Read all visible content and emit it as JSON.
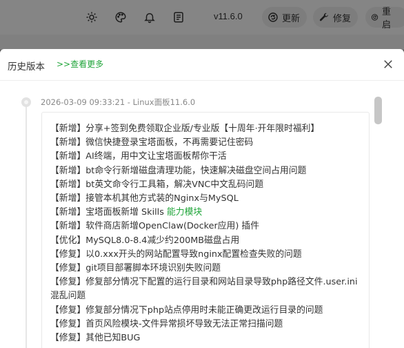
{
  "toolbar": {
    "version": "v11.6.0",
    "update_label": "更新",
    "repair_label": "修复",
    "restart_label": "重启",
    "icons": [
      "sun-icon",
      "palette-icon",
      "bell-icon",
      "notes-icon"
    ]
  },
  "modal": {
    "title": "历史版本",
    "more_link": ">>查看更多",
    "release": {
      "meta": "2026-03-09 09:33:21 - Linux面板11.6.0",
      "notes": [
        {
          "text": "【新增】分享+签到免费领取企业版/专业版【十周年·开年限时福利】"
        },
        {
          "text": "【新增】微信快捷登录宝塔面板，不再需要记住密码"
        },
        {
          "text": "【新增】AI终端，用中文让宝塔面板帮你干活"
        },
        {
          "text": "【新增】bt命令行新增磁盘清理功能，快速解决磁盘空间占用问题"
        },
        {
          "text": "【新增】bt英文命令行工具箱，解决VNC中文乱码问题"
        },
        {
          "text": "【新增】接管本机其他方式装的Nginx与MySQL"
        },
        {
          "text": "【新增】宝塔面板新增 Skills ",
          "highlight": "能力模块"
        },
        {
          "text": "【新增】软件商店新增OpenClaw(Docker应用) 插件"
        },
        {
          "text": "【优化】MySQL8.0-8.4减少约200MB磁盘占用"
        },
        {
          "text": "【修复】以0.xxx开头的网站配置导致nginx配置检查失败的问题"
        },
        {
          "text": "【修复】git项目部署脚本环境识别失败问题"
        },
        {
          "text": "【修复】修复部分情况下配置的运行目录和网站目录导致php路径文件.user.ini混乱问题"
        },
        {
          "text": "【修复】修复部分情况下php站点停用时未能正确更改运行目录的问题"
        },
        {
          "text": "【修复】首页风险模块-文件异常损坏导致无法正常扫描问题"
        },
        {
          "text": "【修复】其他已知BUG"
        }
      ]
    }
  },
  "colors": {
    "accent": "#20a53a",
    "overlay": "rgba(0,0,0,0.45)"
  }
}
